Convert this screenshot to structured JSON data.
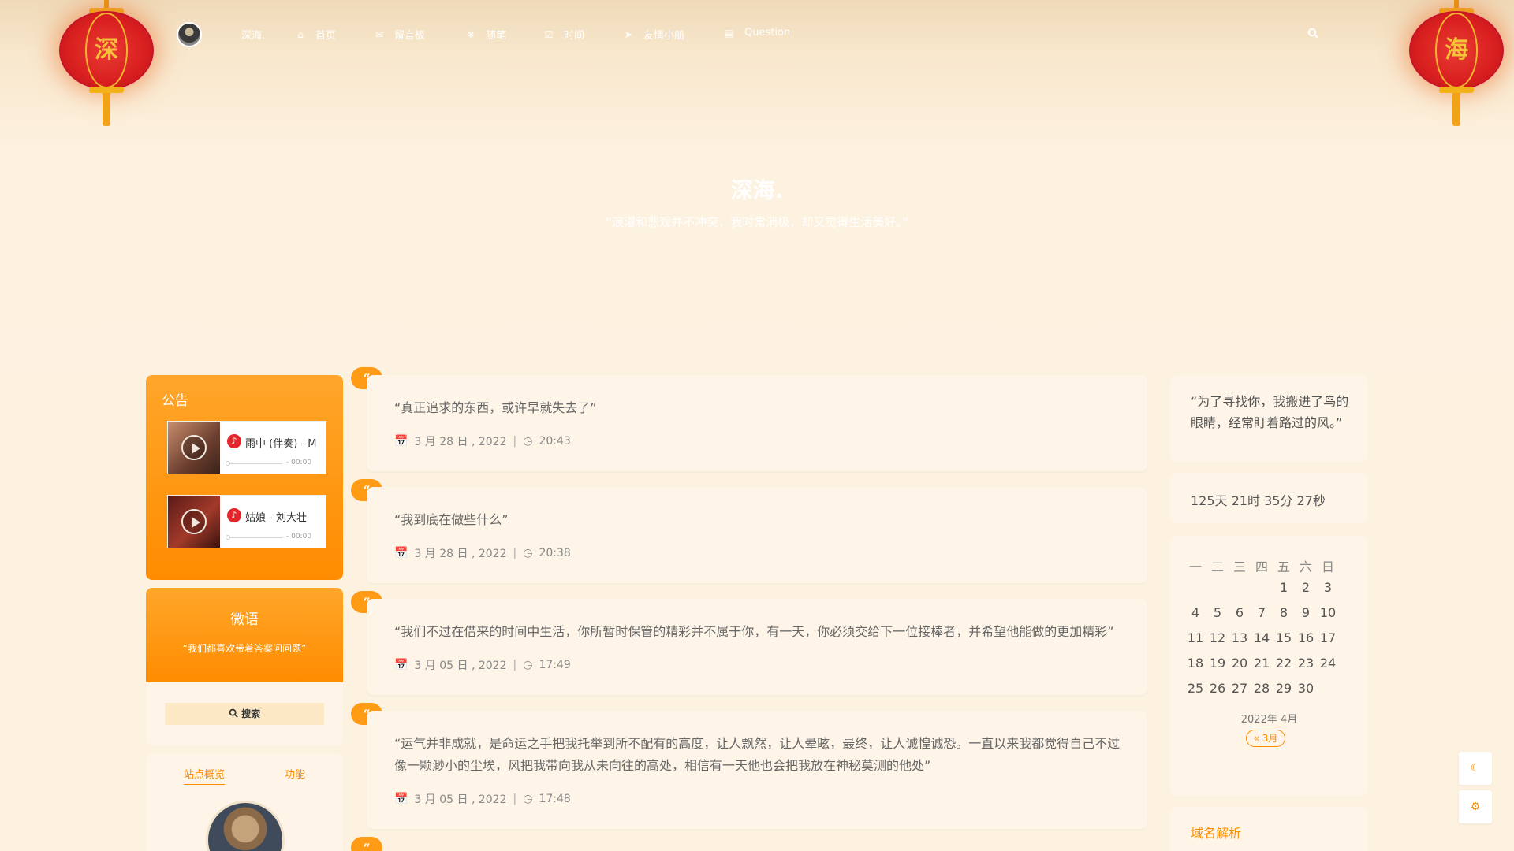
{
  "nav": {
    "brand": "深海.",
    "items": [
      {
        "label": "首页",
        "icon": "home-icon"
      },
      {
        "label": "留言板",
        "icon": "envelope-icon"
      },
      {
        "label": "随笔",
        "icon": "snowflake-icon"
      },
      {
        "label": "时间",
        "icon": "check-square-icon"
      },
      {
        "label": "友情小船",
        "icon": "paper-plane-icon"
      },
      {
        "label": "Question",
        "icon": "window-icon"
      }
    ],
    "search_icon": "search-icon"
  },
  "lanterns": {
    "left_char": "深",
    "right_char": "海"
  },
  "hero": {
    "title": "深海.",
    "subtitle": "“浪漫和悲观并不冲突，我时常消极，却又觉得生活美好。”"
  },
  "notice": {
    "title": "公告",
    "players": [
      {
        "track": "雨中 (伴奏) - M",
        "time": "- 00:00"
      },
      {
        "track": "姑娘 - 刘大壮",
        "time": "- 00:00"
      }
    ]
  },
  "whisper": {
    "title": "微语",
    "subtitle": "“我们都喜欢带着答案问问题”",
    "search_label": "搜索"
  },
  "overview": {
    "tabs": [
      "站点概览",
      "功能"
    ]
  },
  "posts": [
    {
      "text": "“真正追求的东西，或许早就失去了”",
      "date": "3 月 28 日 , 2022",
      "time": "20:43"
    },
    {
      "text": "“我到底在做些什么”",
      "date": "3 月 28 日 , 2022",
      "time": "20:38"
    },
    {
      "text": "“我们不过在借来的时间中生活，你所暂时保管的精彩并不属于你，有一天，你必须交给下一位接棒者，并希望他能做的更加精彩”",
      "date": "3 月 05 日 , 2022",
      "time": "17:49"
    },
    {
      "text": "“运气并非成就，是命运之手把我托举到所不配有的高度，让人飘然，让人晕眩，最终，让人诚惶诚恐。一直以来我都觉得自己不过像一颗渺小的尘埃，风把我带向我从未向往的高处，相信有一天他也会把我放在神秘莫测的他处”",
      "date": "3 月 05 日 , 2022",
      "time": "17:48"
    }
  ],
  "quote_mark": "“",
  "slogan": "“为了寻找你，我搬进了鸟的眼睛，经常盯着路过的风。”",
  "uptime": "125天 21时 35分 27秒",
  "calendar": {
    "weekdays": [
      "一",
      "二",
      "三",
      "四",
      "五",
      "六",
      "日"
    ],
    "rows": [
      [
        "",
        "",
        "",
        "",
        "1",
        "2",
        "3"
      ],
      [
        "4",
        "5",
        "6",
        "7",
        "8",
        "9",
        "10"
      ],
      [
        "11",
        "12",
        "13",
        "14",
        "15",
        "16",
        "17"
      ],
      [
        "18",
        "19",
        "20",
        "21",
        "22",
        "23",
        "24"
      ],
      [
        "25",
        "26",
        "27",
        "28",
        "29",
        "30",
        ""
      ]
    ],
    "caption": "2022年 4月",
    "prev": "« 3月"
  },
  "domain": {
    "title": "域名解析"
  },
  "float_buttons": [
    "moon-icon",
    "gear-icon"
  ],
  "colors": {
    "accent": "#ff8c00",
    "background": "#fdf1df",
    "card": "#fef5e8",
    "lantern": "#d81f1f"
  }
}
